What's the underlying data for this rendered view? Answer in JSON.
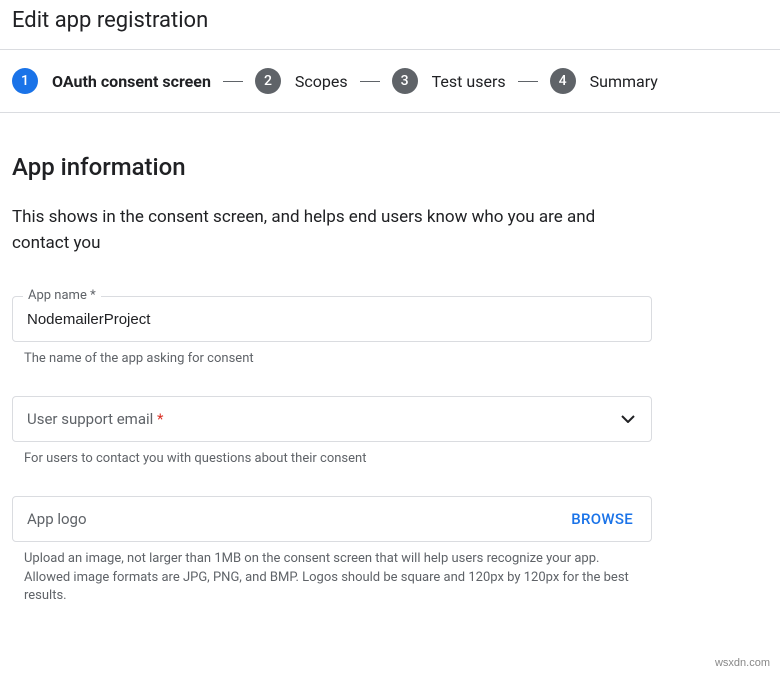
{
  "page_title": "Edit app registration",
  "stepper": {
    "steps": [
      {
        "num": "1",
        "label": "OAuth consent screen",
        "active": true
      },
      {
        "num": "2",
        "label": "Scopes",
        "active": false
      },
      {
        "num": "3",
        "label": "Test users",
        "active": false
      },
      {
        "num": "4",
        "label": "Summary",
        "active": false
      }
    ]
  },
  "section": {
    "heading": "App information",
    "description": "This shows in the consent screen, and helps end users know who you are and contact you"
  },
  "fields": {
    "app_name": {
      "label": "App name *",
      "value": "NodemailerProject",
      "helper": "The name of the app asking for consent"
    },
    "support_email": {
      "label": "User support email",
      "required_mark": "*",
      "helper": "For users to contact you with questions about their consent"
    },
    "app_logo": {
      "label": "App logo",
      "browse": "BROWSE",
      "helper": "Upload an image, not larger than 1MB on the consent screen that will help users recognize your app. Allowed image formats are JPG, PNG, and BMP. Logos should be square and 120px by 120px for the best results."
    }
  },
  "watermark": "wsxdn.com"
}
